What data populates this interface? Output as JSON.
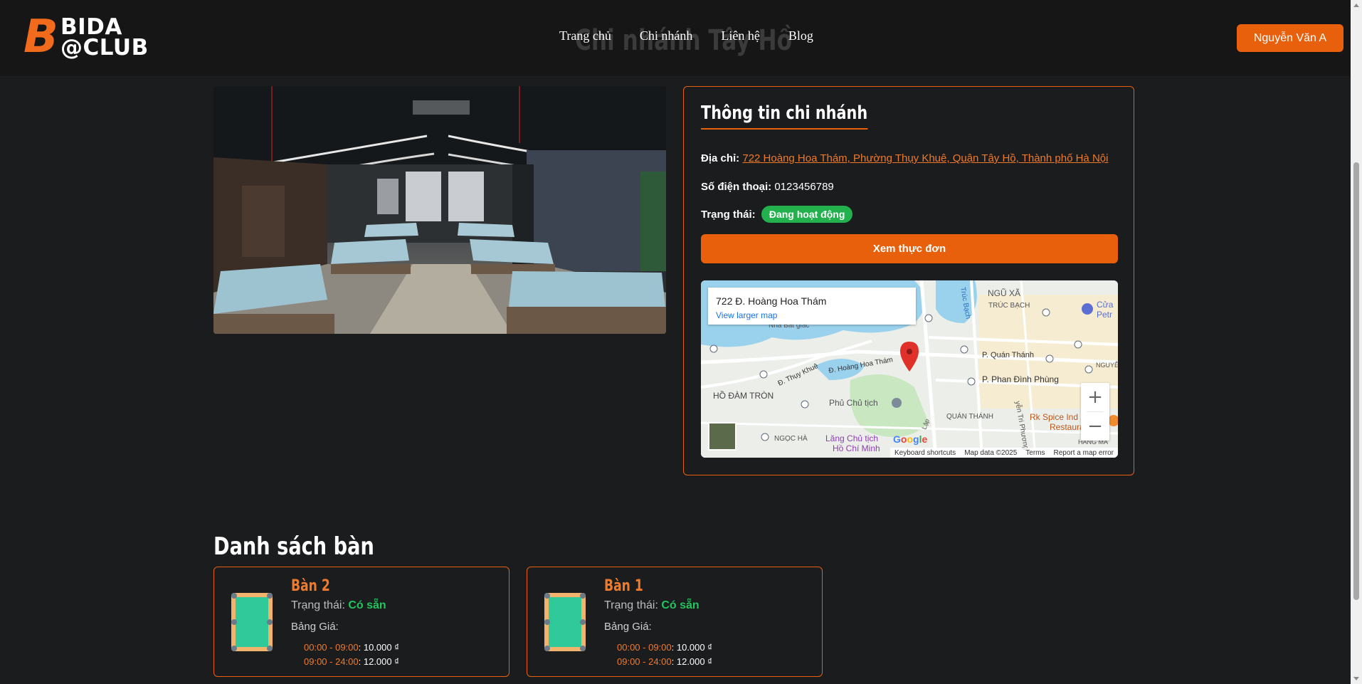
{
  "header": {
    "logo_mark": "B",
    "logo_line1": "BIDA",
    "logo_line2": "@CLUB",
    "ghost_title": "Chi nhánh Tây Hồ",
    "nav": [
      "Trang chủ",
      "Chi nhánh",
      "Liên hệ",
      "Blog"
    ],
    "user_button": "Nguyễn Văn A"
  },
  "info": {
    "title": "Thông tin chi nhánh",
    "address_label": "Địa chỉ:",
    "address": "722 Hoàng Hoa Thám, Phường Thụy Khuê, Quận Tây Hồ, Thành phố Hà Nội",
    "phone_label": "Số điện thoại:",
    "phone": "0123456789",
    "status_label": "Trạng thái:",
    "status": "Đang hoạt động",
    "menu_button": "Xem thực đơn",
    "status_color": "#22b14c",
    "accent": "#e8600c"
  },
  "map": {
    "place": "722 Đ. Hoàng Hoa Thám",
    "view_larger": "View larger map",
    "labels": [
      "NGŨ XÃ",
      "TRÚC BẠCH",
      "Trúc Bạch",
      "P. Quán Thánh",
      "NGUYỄ",
      "Đ. Thụy Khuê",
      "Đ. Hoàng Hoa Thám",
      "HỒ ĐÀM TRÒN",
      "Phủ Chủ tịch",
      "P. Phan Đình Phùng",
      "QUÁN THÁNH",
      "Rk Spice Ind",
      "Restaura",
      "NGỌC HÀ",
      "Lăng Chủ tịch",
      "Hồ Chí Minh",
      "HÀNG MA",
      "Cửa",
      "Petr",
      "Nhà Bát giác",
      "yễn Tri Phương",
      "Lập"
    ],
    "google": "Google",
    "footer": [
      "Keyboard shortcuts",
      "Map data ©2025",
      "Terms",
      "Report a map error"
    ],
    "zoom_in": "+",
    "zoom_out": "−"
  },
  "tables": {
    "title": "Danh sách bàn",
    "items": [
      {
        "name": "Bàn 2",
        "status_label": "Trạng thái:",
        "status": "Có sẵn",
        "price_label": "Bảng Giá:",
        "prices": [
          {
            "range": "00:00 - 09:00",
            "price": "10.000 ₫"
          },
          {
            "range": "09:00 - 24:00",
            "price": "12.000 ₫"
          }
        ]
      },
      {
        "name": "Bàn 1",
        "status_label": "Trạng thái:",
        "status": "Có sẵn",
        "price_label": "Bảng Giá:",
        "prices": [
          {
            "range": "00:00 - 09:00",
            "price": "10.000 ₫"
          },
          {
            "range": "09:00 - 24:00",
            "price": "12.000 ₫"
          }
        ]
      }
    ]
  }
}
